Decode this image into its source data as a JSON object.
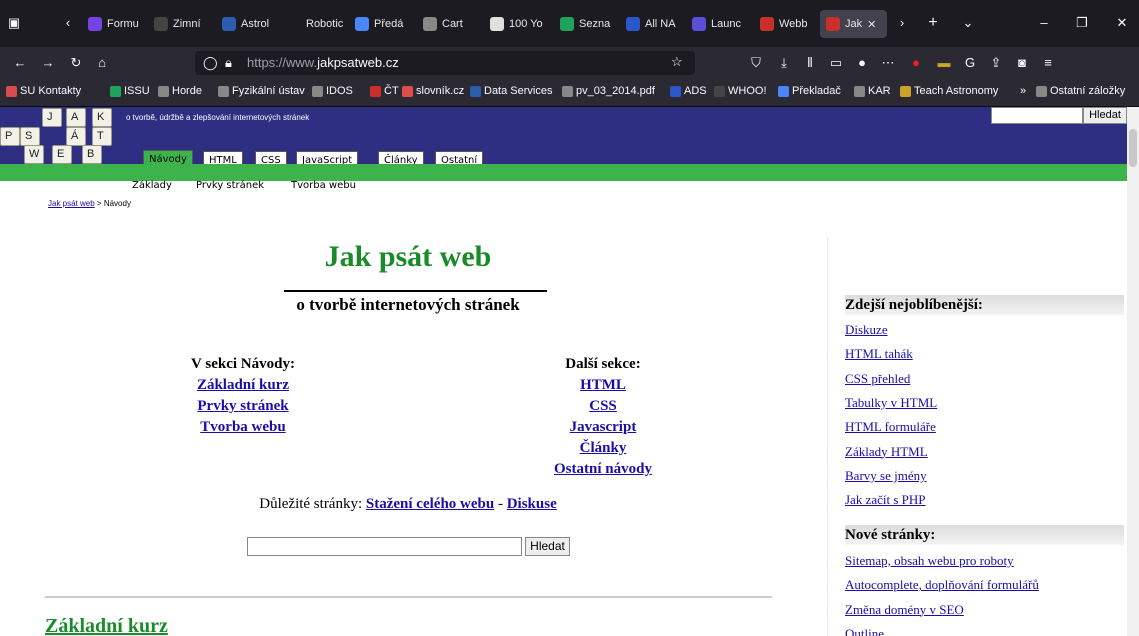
{
  "browser": {
    "tabs": [
      {
        "label": "Formu",
        "color": "#7542e5"
      },
      {
        "label": "Zimní",
        "color": "#444444"
      },
      {
        "label": "Astrol",
        "color": "#2a5db0"
      },
      {
        "label": "Robotic Te",
        "color": "#1c1b22"
      },
      {
        "label": "Předá",
        "color": "#4a86f7"
      },
      {
        "label": "Cart",
        "color": "#888888"
      },
      {
        "label": "100 Yo",
        "color": "#e0e0e0"
      },
      {
        "label": "Sezna",
        "color": "#1fa35c"
      },
      {
        "label": "All NA",
        "color": "#2b58c9"
      },
      {
        "label": "Launc",
        "color": "#5a4fd6"
      },
      {
        "label": "Webb",
        "color": "#c9302c"
      },
      {
        "label": "Jak",
        "color": "#c9302c"
      }
    ],
    "url_prefix": "https://www.",
    "url_domain": "jakpsatweb.cz",
    "bookmarks": [
      {
        "label": "SU Kontakty",
        "color": "#d84b4b"
      },
      {
        "label": "ISSU",
        "color": "#1fa35c"
      },
      {
        "label": "Horde",
        "color": "#888888"
      },
      {
        "label": "Fyzikální ústav",
        "color": "#888888"
      },
      {
        "label": "IDOS",
        "color": "#888888"
      },
      {
        "label": "ČT",
        "color": "#c9302c"
      },
      {
        "label": "slovník.cz",
        "color": "#e04b4b"
      },
      {
        "label": "Data Services",
        "color": "#2a5db0"
      },
      {
        "label": "pv_03_2014.pdf",
        "color": "#888888"
      },
      {
        "label": "ADS",
        "color": "#2b58c9"
      },
      {
        "label": "WHOO!",
        "color": "#444444"
      },
      {
        "label": "Překladač",
        "color": "#4a86f7"
      },
      {
        "label": "KAR",
        "color": "#888888"
      },
      {
        "label": "Teach Astronomy",
        "color": "#c9a227"
      },
      {
        "label": "Ostatní záložky",
        "color": "#888888"
      }
    ]
  },
  "site": {
    "keys": [
      "J",
      "A",
      "K",
      "P",
      "S",
      "Á",
      "T",
      "W",
      "E",
      "B"
    ],
    "tagline": "o tvorbě, údržbě a zlepšování internetových stránek",
    "search_button": "Hledat",
    "menu_tabs": [
      "Návody",
      "HTML",
      "CSS",
      "JavaScript",
      "Články",
      "Ostatní"
    ],
    "subnav": [
      "Základy",
      "Prvky stránek",
      "Tvorba webu"
    ],
    "breadcrumb_link": "Jak psát web",
    "breadcrumb_rest": " > Návody"
  },
  "main": {
    "title": "Jak psát web",
    "subtitle": "o tvorbě internetových stránek",
    "left_heading": "V sekci Návody:",
    "left_links": [
      "Základní kurz",
      "Prvky stránek",
      "Tvorba webu"
    ],
    "right_heading": "Další sekce:",
    "right_links": [
      "HTML",
      "CSS",
      "Javascript",
      "Články",
      "Ostatní návody"
    ],
    "important_label": "Důležité stránky: ",
    "important_link1": "Stažení celého webu",
    "important_sep": " - ",
    "important_link2": "Diskuse",
    "search_button": "Hledat",
    "section_title": "Základní kurz"
  },
  "sidebar": {
    "popular_heading": "Zdejší nejoblíbenější:",
    "popular": [
      "Diskuze",
      "HTML tahák",
      "CSS přehled",
      "Tabulky v HTML",
      "HTML formuláře",
      "Základy HTML",
      "Barvy se jmény",
      "Jak začít s PHP"
    ],
    "new_heading": "Nové stránky:",
    "new": [
      "Sitemap, obsah webu pro roboty",
      "Autocomplete, doplňování formulářů",
      "Změna domény v SEO",
      "Outline"
    ]
  }
}
